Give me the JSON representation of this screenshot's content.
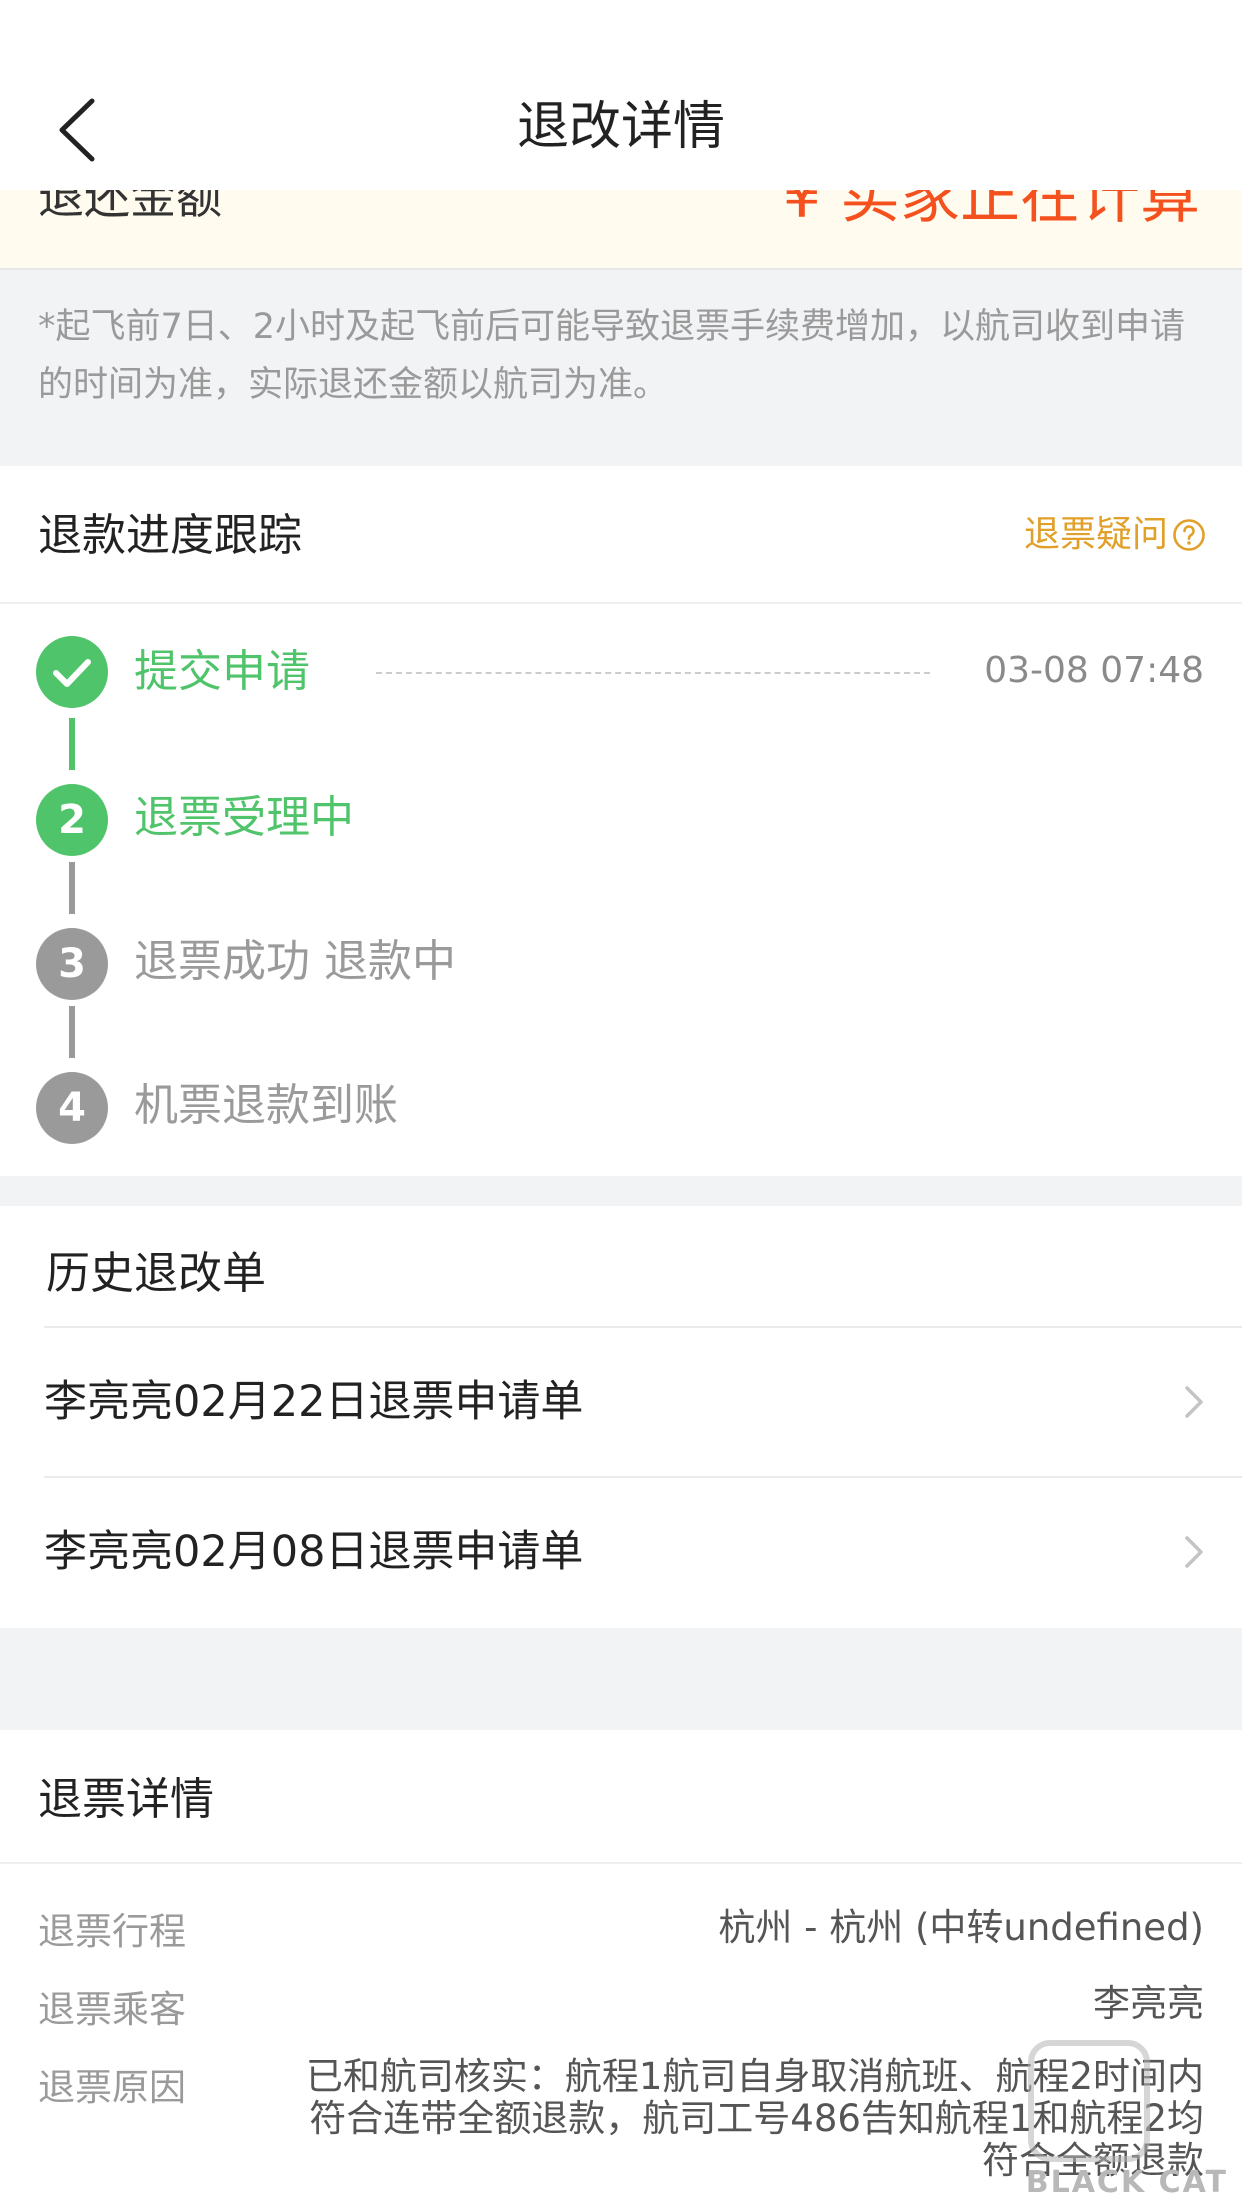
{
  "header": {
    "title": "退改详情"
  },
  "refund_amount": {
    "label": "退还金额",
    "value": "¥ 实家正在计算"
  },
  "notice": "*起飞前7日、2小时及起飞前后可能导致退票手续费增加，以航司收到申请的时间为准，实际退还金额以航司为准。",
  "progress": {
    "title": "退款进度跟踪",
    "help_label": "退票疑问",
    "steps": [
      {
        "num": "",
        "label": "提交申请",
        "time": "03-08 07:48",
        "state": "done"
      },
      {
        "num": "2",
        "label": "退票受理中",
        "state": "active"
      },
      {
        "num": "3",
        "label": "退票成功 退款中",
        "state": "pending"
      },
      {
        "num": "4",
        "label": "机票退款到账",
        "state": "pending"
      }
    ]
  },
  "history": {
    "title": "历史退改单",
    "items": [
      {
        "label": "李亮亮02月22日退票申请单"
      },
      {
        "label": "李亮亮02月08日退票申请单"
      }
    ]
  },
  "details": {
    "title": "退票详情",
    "rows": [
      {
        "label": "退票行程",
        "value": "杭州 - 杭州 (中转undefined)"
      },
      {
        "label": "退票乘客",
        "value": "李亮亮"
      },
      {
        "label": "退票原因",
        "value": "已和航司核实：航程1航司自身取消航班、航程2时间内符合连带全额退款，航司工号486告知航程1和航程2均符合全额退款"
      }
    ]
  },
  "watermark": {
    "text": "BLACK CAT"
  },
  "colors": {
    "accent_green": "#4fc46a",
    "accent_orange": "#f4511e",
    "help_gold": "#e0a02a",
    "pending_gray": "#9a9a9a"
  }
}
